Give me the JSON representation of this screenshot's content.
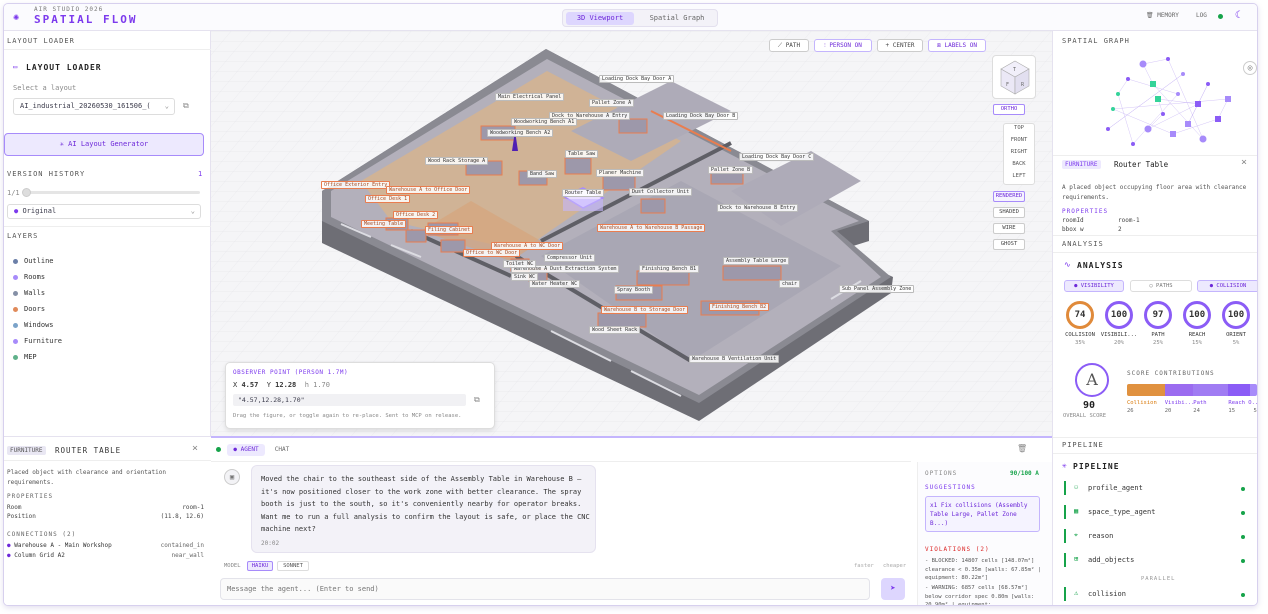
{
  "header": {
    "subtitle": "AIR STUDIO 2026",
    "title": "SPATIAL FLOW",
    "tabs": [
      "3D Viewport",
      "Spatial Graph"
    ],
    "memory": "MEMORY",
    "log": "LOG"
  },
  "left": {
    "loader_header": "LAYOUT LOADER",
    "loader_title": "LAYOUT LOADER",
    "select_label": "Select a layout",
    "layout_value": "AI_industrial_20260530_161506_(",
    "gen_button": "AI Layout Generator",
    "version_title": "VERSION HISTORY",
    "version_count": "1",
    "version_pos": "1/1",
    "version_selected": "Original",
    "layers_title": "LAYERS",
    "layers": [
      {
        "name": "Outline",
        "color": "#6b7fa8"
      },
      {
        "name": "Rooms",
        "color": "#a78bfa"
      },
      {
        "name": "Walls",
        "color": "#8590a6"
      },
      {
        "name": "Doors",
        "color": "#e08a5a"
      },
      {
        "name": "Windows",
        "color": "#7ba3c9"
      },
      {
        "name": "Furniture",
        "color": "#a78bfa"
      },
      {
        "name": "MEP",
        "color": "#5fb18a"
      }
    ]
  },
  "inspector": {
    "tag": "FURNITURE",
    "name": "ROUTER TABLE",
    "desc": "Placed object with clearance and orientation requirements.",
    "props_title": "PROPERTIES",
    "props": [
      {
        "k": "Room",
        "v": "room-1"
      },
      {
        "k": "Position",
        "v": "(11.8, 12.6)"
      }
    ],
    "conn_title": "CONNECTIONS (2)",
    "conns": [
      {
        "k": "Warehouse A - Main Workshop",
        "v": "contained_in"
      },
      {
        "k": "Column Grid A2",
        "v": "near_wall"
      }
    ]
  },
  "viewport": {
    "toolbar": [
      "PATH",
      "PERSON ON",
      "CENTER",
      "LABELS ON"
    ],
    "cube": {
      "top": "T",
      "front": "F",
      "right": "R"
    },
    "views": [
      "ORTHO",
      "TOP",
      "FRONT",
      "RIGHT",
      "BACK",
      "LEFT"
    ],
    "render_modes": [
      "RENDERED",
      "SHADED",
      "WIRE",
      "GHOST"
    ],
    "labels": [
      "Loading Dock Bay Door A",
      "Main Electrical Panel",
      "Pallet Zone A",
      "Dock to Warehouse A Entry",
      "Woodworking Bench A1",
      "Loading Dock Bay Door B",
      "Woodworking Bench A2",
      "Wood Rack Storage A",
      "Table Saw",
      "Loading Dock Bay Door C",
      "Pallet Zone B",
      "Band Saw",
      "Planer Machine",
      "Office Exterior Entry",
      "Warehouse A to Office Door",
      "Router Table",
      "Dust Collector Unit",
      "Office Desk 1",
      "Office Desk 2",
      "Dock to Warehouse B Entry",
      "Meeting Table",
      "Filing Cabinet",
      "Warehouse A to Warehouse B Passage",
      "Warehouse A to WC Door",
      "Office to WC Door",
      "Compressor Unit",
      "Warehouse A Dust Extraction System",
      "Finishing Bench B1",
      "Assembly Table Large",
      "Sink WC",
      "Water Heater WC",
      "chair",
      "Spray Booth",
      "Sub Panel Assembly Zone",
      "Warehouse B to Storage Door",
      "Finishing Bench B2",
      "Wood Sheet Rack",
      "Warehouse B Ventilation Unit",
      "Toilet WC"
    ],
    "observer": {
      "title": "OBSERVER POINT (PERSON 1.7M)",
      "x_label": "X",
      "x": "4.57",
      "y_label": "Y",
      "y": "12.28",
      "h": "h 1.70",
      "coord": "\"4.57,12.28,1.70\"",
      "hint": "Drag the figure, or toggle again to re-place. Sent to MCP on release."
    }
  },
  "chat": {
    "tabs": [
      "AGENT",
      "CHAT"
    ],
    "message": "Moved the chair to the southeast side of the Assembly Table in Warehouse B — it's now positioned closer to the work zone with better clearance. The spray booth is just to the south, so it's conveniently nearby for operator breaks. Want me to run a full analysis to confirm the layout is safe, or place the CNC machine next?",
    "time": "20:02",
    "model_label": "MODEL",
    "models": [
      "HAIKU",
      "SONNET"
    ],
    "faster": "faster",
    "cheaper": "cheaper",
    "placeholder": "Message the agent... (Enter to send)",
    "options_title": "OPTIONS",
    "options_score": "90/100 A",
    "sugg_title": "SUGGESTIONS",
    "suggestion": "x1 Fix collisions (Assembly Table Large, Pallet Zone B...)",
    "viol_title": "VIOLATIONS (2)",
    "violations": [
      "- BLOCKED: 14807 cells [148.07m²] clearance < 0.35m [walls: 67.85m² | equipment: 80.22m²]",
      "- WARNING: 6857 cells [68.57m²] below corridor spec 0.80m [walls: 20.90m² | equipment:"
    ]
  },
  "right": {
    "graph_title": "SPATIAL GRAPH",
    "sel_tag": "FURNITURE",
    "sel_name": "Router Table",
    "sel_desc": "A placed object occupying floor area with clearance requirements.",
    "props_title": "PROPERTIES",
    "props": [
      {
        "k": "roomId",
        "v": "room-1"
      },
      {
        "k": "bbox w",
        "v": "2"
      }
    ],
    "analysis_header": "ANALYSIS",
    "analysis_title": "ANALYSIS",
    "analysis_tabs": [
      "VISIBILITY",
      "PATHS",
      "COLLISION"
    ],
    "scores": [
      {
        "v": "74",
        "name": "COLLISION",
        "w": "35%",
        "color": "#e08a3a"
      },
      {
        "v": "100",
        "name": "VISIBILI...",
        "w": "20%",
        "color": "#8b5cf6"
      },
      {
        "v": "97",
        "name": "PATH",
        "w": "25%",
        "color": "#8b5cf6"
      },
      {
        "v": "100",
        "name": "REACH",
        "w": "15%",
        "color": "#8b5cf6"
      },
      {
        "v": "100",
        "name": "ORIENT",
        "w": "5%",
        "color": "#8b5cf6"
      }
    ],
    "grade": "A",
    "overall": "90",
    "overall_label": "OVERALL SCORE",
    "contrib_title": "SCORE CONTRIBUTIONS",
    "contribs": [
      {
        "name": "Collision",
        "v": "26",
        "frac": 0.29,
        "color": "#e0913f"
      },
      {
        "name": "Visibi...",
        "v": "20",
        "frac": 0.22,
        "color": "#9b6cf0"
      },
      {
        "name": "Path",
        "v": "24",
        "frac": 0.27,
        "color": "#a07cf3"
      },
      {
        "name": "Reach O...",
        "v": "15",
        "frac": 0.17,
        "color": "#8b5cf6"
      },
      {
        "name": "",
        "v": "5",
        "frac": 0.05,
        "color": "#a78bfa"
      }
    ],
    "pipeline_header": "PIPELINE",
    "pipeline_title": "PIPELINE",
    "steps": [
      "profile_agent",
      "space_type_agent",
      "reason",
      "add_objects"
    ],
    "parallel": "PARALLEL",
    "collision_step": "collision"
  }
}
